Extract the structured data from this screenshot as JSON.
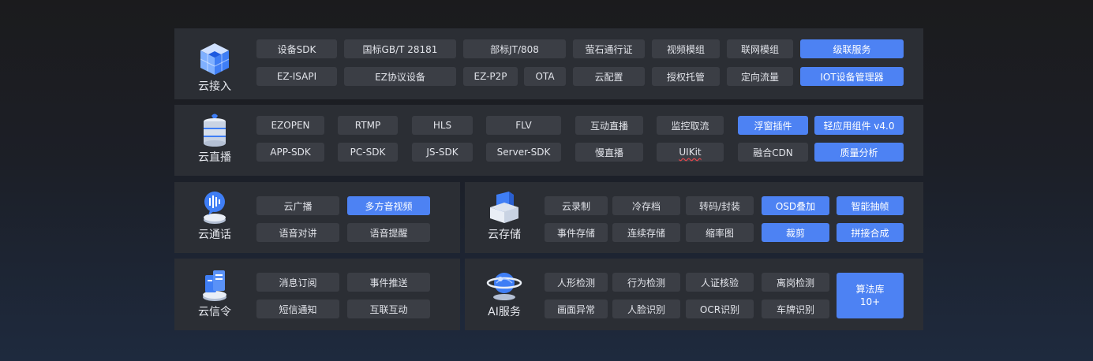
{
  "colors": {
    "panel": "#2b2e34",
    "tag": "#3b3e45",
    "highlight": "#4d82f3",
    "text": "#e2e4ea"
  },
  "access": {
    "label": "云接入",
    "icon": "cube-grid-icon",
    "row1": [
      "设备SDK",
      "国标GB/T 28181",
      "部标JT/808",
      "萤石通行证",
      "视频模组",
      "联网模组",
      "级联服务"
    ],
    "row2": [
      "EZ-ISAPI",
      "EZ协议设备",
      "EZ-P2P",
      "OTA",
      "云配置",
      "授权托管",
      "定向流量",
      "IOT设备管理器"
    ]
  },
  "live": {
    "label": "云直播",
    "icon": "server-stack-icon",
    "row1": [
      "EZOPEN",
      "RTMP",
      "HLS",
      "FLV",
      "互动直播",
      "监控取流",
      "浮窗插件",
      "轻应用组件 v4.0"
    ],
    "row2": [
      "APP-SDK",
      "PC-SDK",
      "JS-SDK",
      "Server-SDK",
      "慢直播",
      "UIKit",
      "融合CDN",
      "质量分析"
    ]
  },
  "talk": {
    "label": "云通话",
    "icon": "voice-bubble-icon",
    "row1": [
      "云广播",
      "多方音视频"
    ],
    "row2": [
      "语音对讲",
      "语音提醒"
    ]
  },
  "storage": {
    "label": "云存储",
    "icon": "storage-box-icon",
    "row1": [
      "云录制",
      "冷存档",
      "转码/封装",
      "OSD叠加",
      "智能抽帧"
    ],
    "row2": [
      "事件存储",
      "连续存储",
      "缩率图",
      "裁剪",
      "拼接合成"
    ]
  },
  "signal": {
    "label": "云信令",
    "icon": "signal-cards-icon",
    "row1": [
      "消息订阅",
      "事件推送"
    ],
    "row2": [
      "短信通知",
      "互联互动"
    ]
  },
  "ai": {
    "label": "AI服务",
    "icon": "ai-globe-icon",
    "row1": [
      "人形检测",
      "行为检测",
      "人证核验",
      "离岗检测"
    ],
    "row2": [
      "画面异常",
      "人脸识别",
      "OCR识别",
      "车牌识别"
    ],
    "library": "算法库\n10+"
  }
}
